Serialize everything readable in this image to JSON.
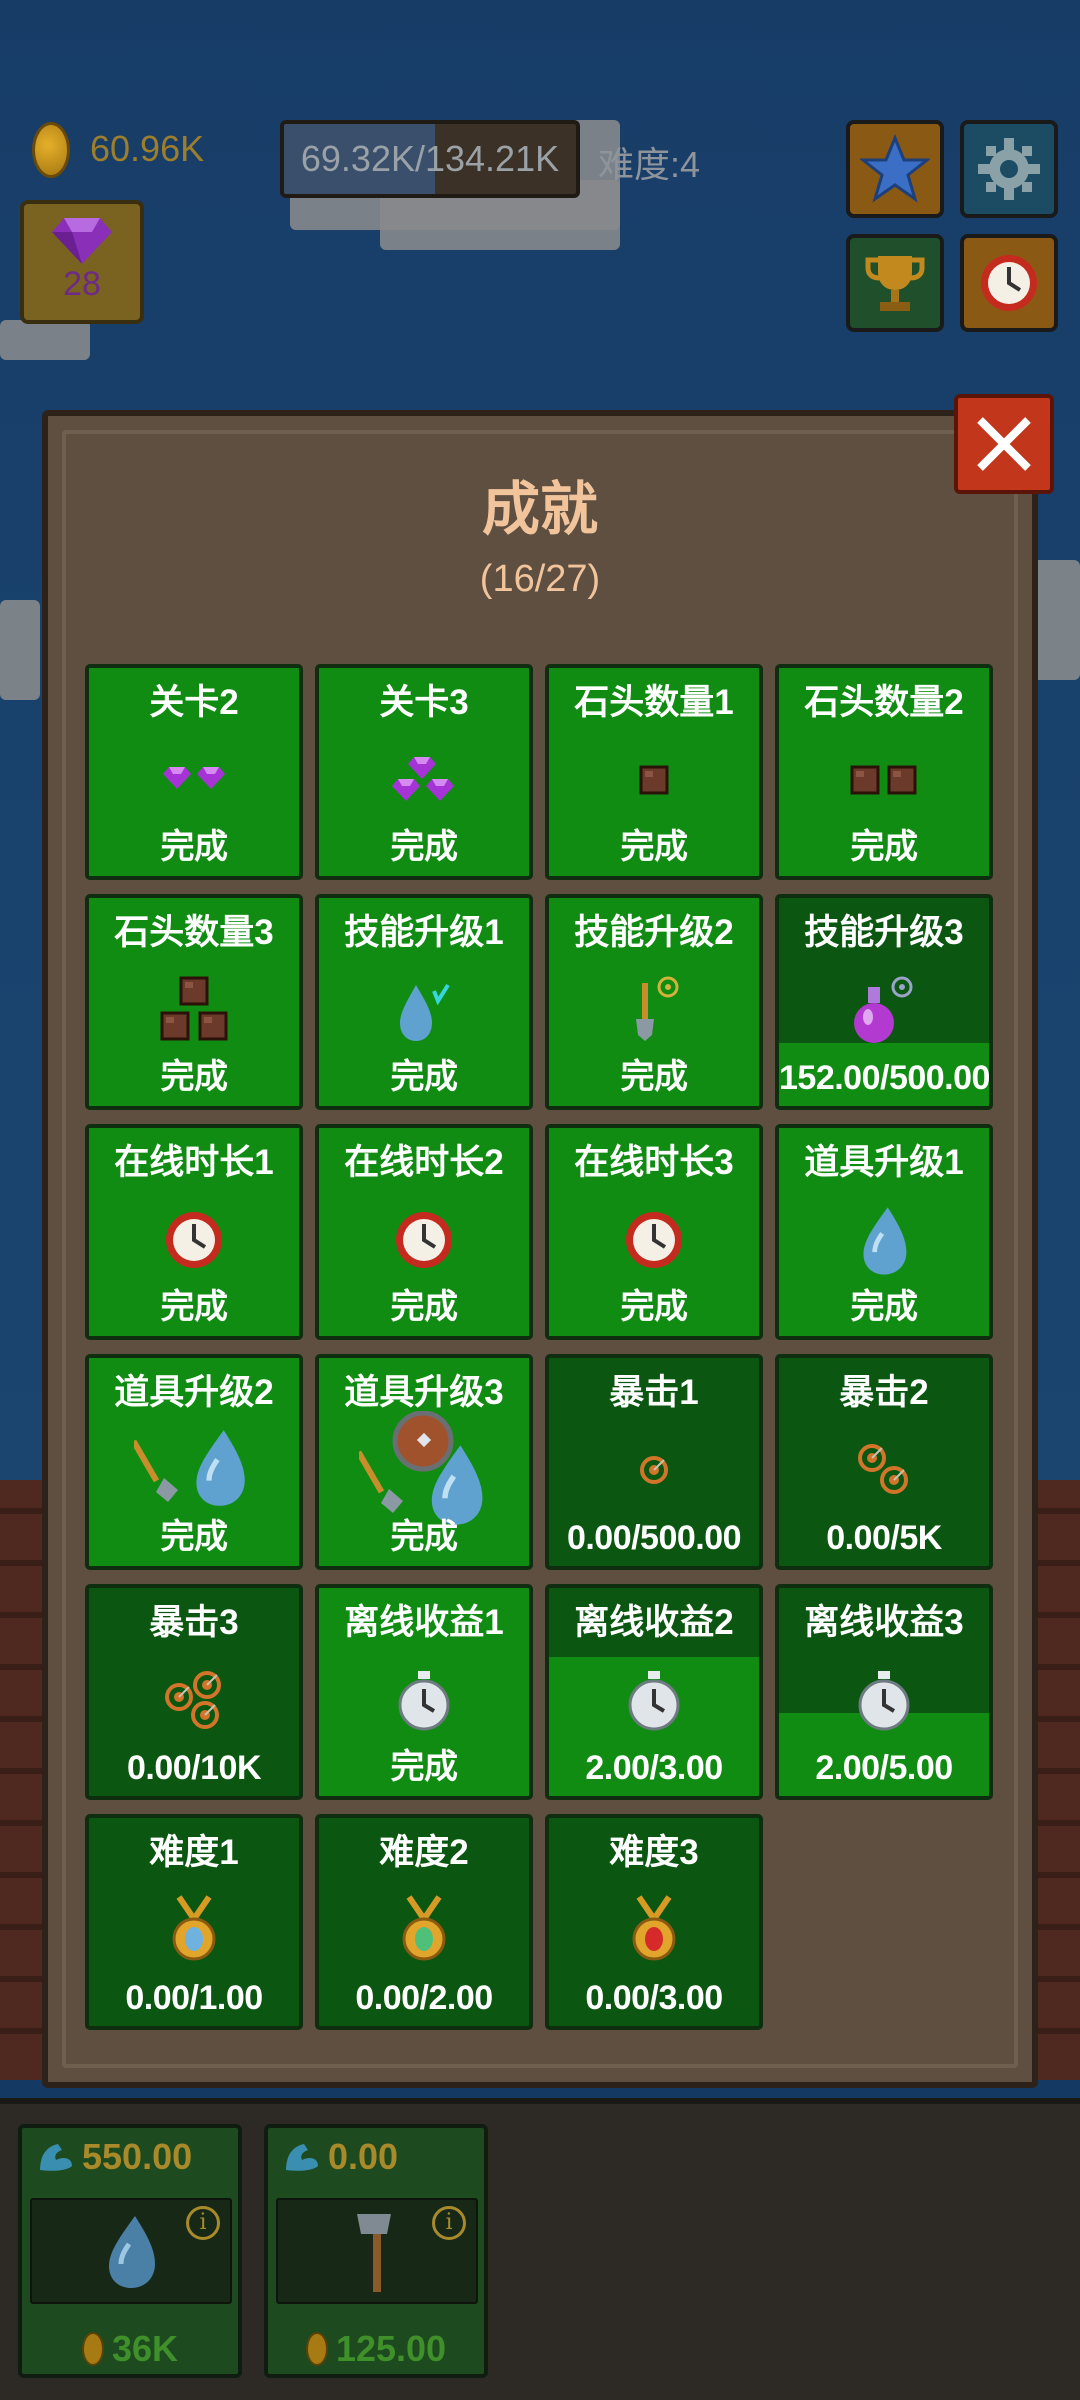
{
  "hud": {
    "coins": "60.96K",
    "progress_text": "69.32K/134.21K",
    "progress_fraction": 0.517,
    "difficulty": "难度:4",
    "gems": "28",
    "buttons": [
      "star-icon",
      "gear-icon",
      "trophy-icon",
      "clock-icon"
    ]
  },
  "panel": {
    "title": "成就",
    "count": "(16/27)"
  },
  "achievements": [
    {
      "name": "关卡2",
      "status": "完成",
      "done": true,
      "progress": 1,
      "icon": "two-gems-icon"
    },
    {
      "name": "关卡3",
      "status": "完成",
      "done": true,
      "progress": 1,
      "icon": "three-gems-icon"
    },
    {
      "name": "石头数量1",
      "status": "完成",
      "done": true,
      "progress": 1,
      "icon": "one-stone-icon"
    },
    {
      "name": "石头数量2",
      "status": "完成",
      "done": true,
      "progress": 1,
      "icon": "two-stones-icon"
    },
    {
      "name": "石头数量3",
      "status": "完成",
      "done": true,
      "progress": 1,
      "icon": "three-stones-icon"
    },
    {
      "name": "技能升级1",
      "status": "完成",
      "done": true,
      "progress": 1,
      "icon": "water-drop-skill-icon"
    },
    {
      "name": "技能升级2",
      "status": "完成",
      "done": true,
      "progress": 1,
      "icon": "shovel-skill-icon"
    },
    {
      "name": "技能升级3",
      "status": "152.00/500.00",
      "done": false,
      "progress": 0.304,
      "icon": "potion-icon"
    },
    {
      "name": "在线时长1",
      "status": "完成",
      "done": true,
      "progress": 1,
      "icon": "clock-icon"
    },
    {
      "name": "在线时长2",
      "status": "完成",
      "done": true,
      "progress": 1,
      "icon": "clock-icon"
    },
    {
      "name": "在线时长3",
      "status": "完成",
      "done": true,
      "progress": 1,
      "icon": "clock-icon"
    },
    {
      "name": "道具升级1",
      "status": "完成",
      "done": true,
      "progress": 1,
      "icon": "water-drop-icon"
    },
    {
      "name": "道具升级2",
      "status": "完成",
      "done": true,
      "progress": 1,
      "icon": "shovel-and-drop-icon"
    },
    {
      "name": "道具升级3",
      "status": "完成",
      "done": true,
      "progress": 1,
      "icon": "shield-shovel-drop-icon"
    },
    {
      "name": "暴击1",
      "status": "0.00/500.00",
      "done": false,
      "progress": 0,
      "icon": "target-icon"
    },
    {
      "name": "暴击2",
      "status": "0.00/5K",
      "done": false,
      "progress": 0,
      "icon": "two-targets-icon"
    },
    {
      "name": "暴击3",
      "status": "0.00/10K",
      "done": false,
      "progress": 0,
      "icon": "three-targets-icon"
    },
    {
      "name": "离线收益1",
      "status": "完成",
      "done": true,
      "progress": 1,
      "icon": "stopwatch-icon"
    },
    {
      "name": "离线收益2",
      "status": "2.00/3.00",
      "done": false,
      "progress": 0.667,
      "icon": "stopwatch-icon"
    },
    {
      "name": "离线收益3",
      "status": "2.00/5.00",
      "done": false,
      "progress": 0.4,
      "icon": "stopwatch-icon"
    },
    {
      "name": "难度1",
      "status": "0.00/1.00",
      "done": false,
      "progress": 0,
      "icon": "blue-medal-icon"
    },
    {
      "name": "难度2",
      "status": "0.00/2.00",
      "done": false,
      "progress": 0,
      "icon": "green-medal-icon"
    },
    {
      "name": "难度3",
      "status": "0.00/3.00",
      "done": false,
      "progress": 0,
      "icon": "red-medal-icon"
    }
  ],
  "tools": [
    {
      "power": "550.00",
      "cost": "36K",
      "icon": "water-drop-icon"
    },
    {
      "power": "0.00",
      "cost": "125.00",
      "icon": "axe-icon"
    }
  ],
  "colors": {
    "done": "#108c13",
    "pending": "#0b5610",
    "title": "#f2c49b",
    "close": "#c2361b"
  }
}
